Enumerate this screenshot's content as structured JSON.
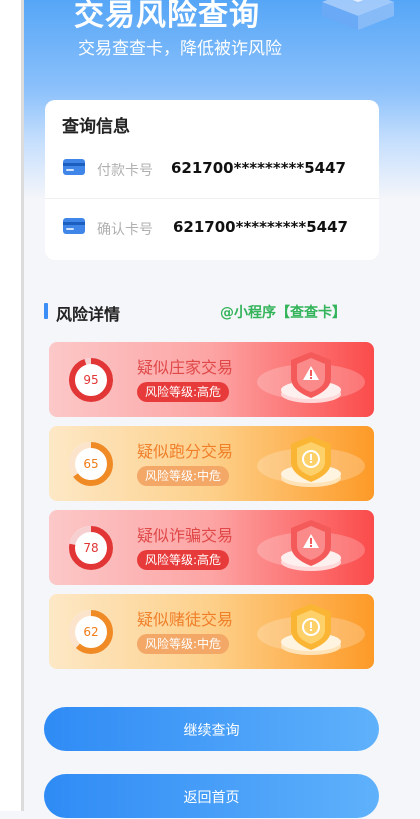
{
  "hero": {
    "title": "交易风险查询",
    "subtitle": "交易查查卡，降低被诈风险"
  },
  "query_card": {
    "title": "查询信息",
    "rows": [
      {
        "label": "付款卡号",
        "value": "621700*********5447",
        "icon": "bank-card-icon"
      },
      {
        "label": "确认卡号",
        "value": "621700*********5447",
        "icon": "bank-card-icon"
      }
    ]
  },
  "risk_section": {
    "title": "风险详情",
    "watermark": "@小程序【查查卡】",
    "items": [
      {
        "name": "疑似庄家交易",
        "score": "95",
        "level": "风险等级:高危",
        "tone": "high",
        "icon": "warning-shield-icon",
        "progress_percent": 95
      },
      {
        "name": "疑似跑分交易",
        "score": "65",
        "level": "风险等级:中危",
        "tone": "medium",
        "icon": "alert-shield-icon",
        "progress_percent": 65
      },
      {
        "name": "疑似诈骗交易",
        "score": "78",
        "level": "风险等级:高危",
        "tone": "high",
        "icon": "warning-shield-icon",
        "progress_percent": 78
      },
      {
        "name": "疑似赌徒交易",
        "score": "62",
        "level": "风险等级:中危",
        "tone": "medium",
        "icon": "alert-shield-icon",
        "progress_percent": 62
      }
    ]
  },
  "buttons": {
    "continue_label": "继续查询",
    "home_label": "返回首页"
  },
  "colors": {
    "primary": "#2f8bf5",
    "high_risk": "#e73b3b",
    "medium_risk": "#f3a867",
    "watermark": "#33b45a"
  }
}
